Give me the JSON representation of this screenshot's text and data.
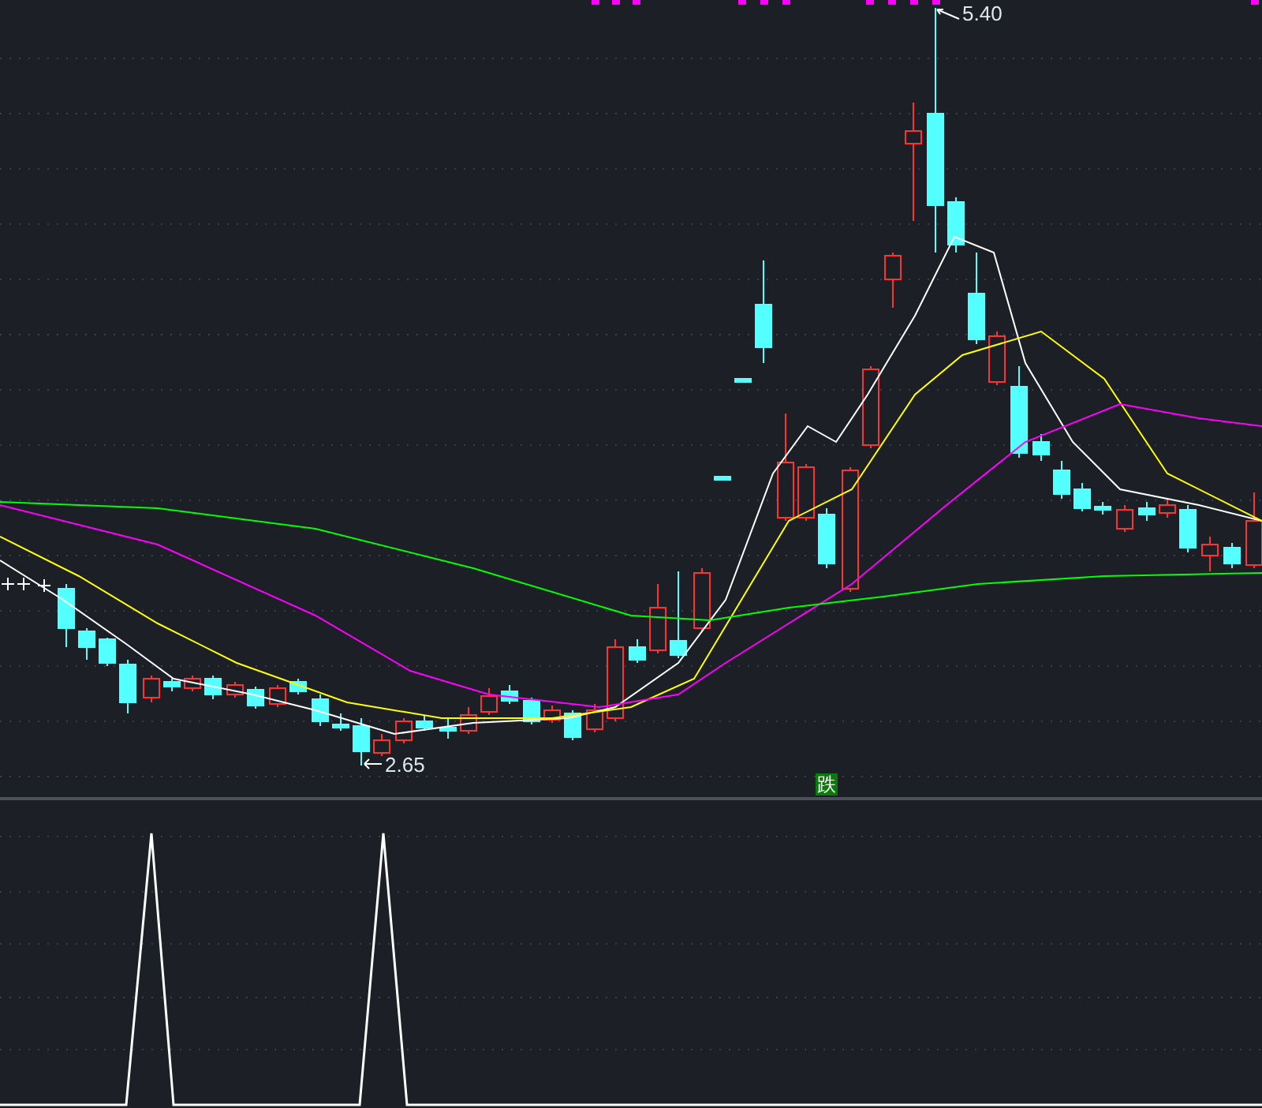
{
  "main_chart": {
    "high_label": "5.40",
    "low_label": "2.65",
    "signal_badge": "跌"
  }
}
